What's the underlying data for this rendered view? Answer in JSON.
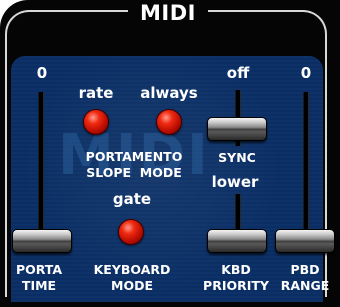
{
  "title": "MIDI",
  "watermark": "MIDI",
  "porta_time": {
    "value": "0",
    "label_line1": "PORTA",
    "label_line2": "TIME",
    "level": 0
  },
  "portamento": {
    "slope_value": "rate",
    "mode_value": "always",
    "label_line1": "PORTAMENTO",
    "label_line2": "SLOPE  MODE"
  },
  "keyboard_mode": {
    "value": "gate",
    "label_line1": "KEYBOARD",
    "label_line2": "MODE"
  },
  "sync": {
    "value": "off",
    "label": "SYNC"
  },
  "kbd_priority": {
    "value": "lower",
    "label_line1": "KBD",
    "label_line2": "PRIORITY",
    "level": 0
  },
  "pbd_range": {
    "value": "0",
    "label_line1": "PBD",
    "label_line2": "RANGE",
    "level": 0
  },
  "colors": {
    "panel": "#0a2f66",
    "led": "#e01a05",
    "frame": "#050505"
  }
}
